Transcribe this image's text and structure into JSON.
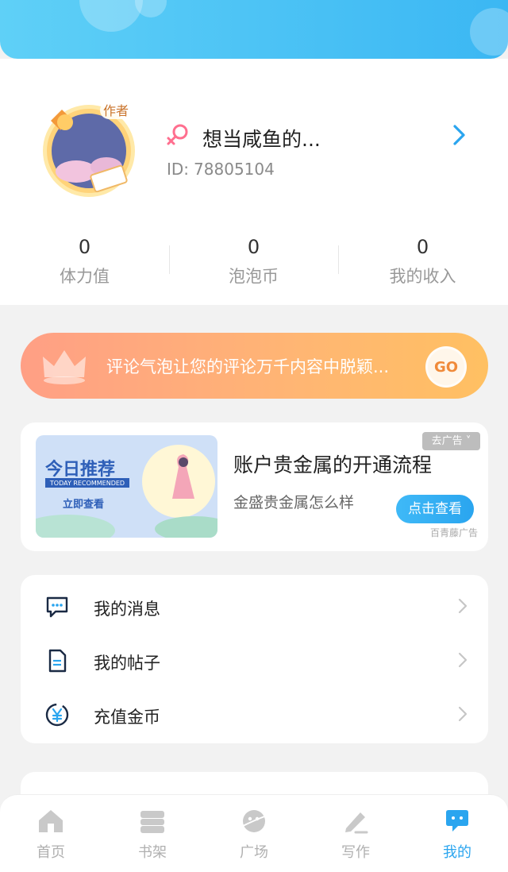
{
  "profile": {
    "username": "想当咸鱼的...",
    "id_label": "ID:",
    "id_value": "78805104",
    "badge": "作者"
  },
  "stats": [
    {
      "value": "0",
      "label": "体力值"
    },
    {
      "value": "0",
      "label": "泡泡币"
    },
    {
      "value": "0",
      "label": "我的收入"
    }
  ],
  "promo": {
    "text": "评论气泡让您的评论万千内容中脱颖...",
    "go_label": "GO"
  },
  "ad": {
    "image_title": "今日推荐",
    "image_subtitle": "TODAY RECOMMENDED",
    "image_cta": "立即查看",
    "title": "账户贵金属的开通流程",
    "subtitle": "金盛贵金属怎么样",
    "button": "点击查看",
    "close_label": "去广告",
    "source": "百青藤广告"
  },
  "menu": [
    {
      "label": "我的消息",
      "icon": "message-icon"
    },
    {
      "label": "我的帖子",
      "icon": "document-icon"
    },
    {
      "label": "充值金币",
      "icon": "yuan-coin-icon"
    }
  ],
  "tabs": [
    {
      "label": "首页",
      "icon": "home-icon",
      "active": false
    },
    {
      "label": "书架",
      "icon": "bookshelf-icon",
      "active": false
    },
    {
      "label": "广场",
      "icon": "plaza-icon",
      "active": false
    },
    {
      "label": "写作",
      "icon": "write-icon",
      "active": false
    },
    {
      "label": "我的",
      "icon": "me-icon",
      "active": true
    }
  ],
  "colors": {
    "accent": "#2aa5ef",
    "banner": "#3bb7f3",
    "promo": "#ffb673"
  }
}
